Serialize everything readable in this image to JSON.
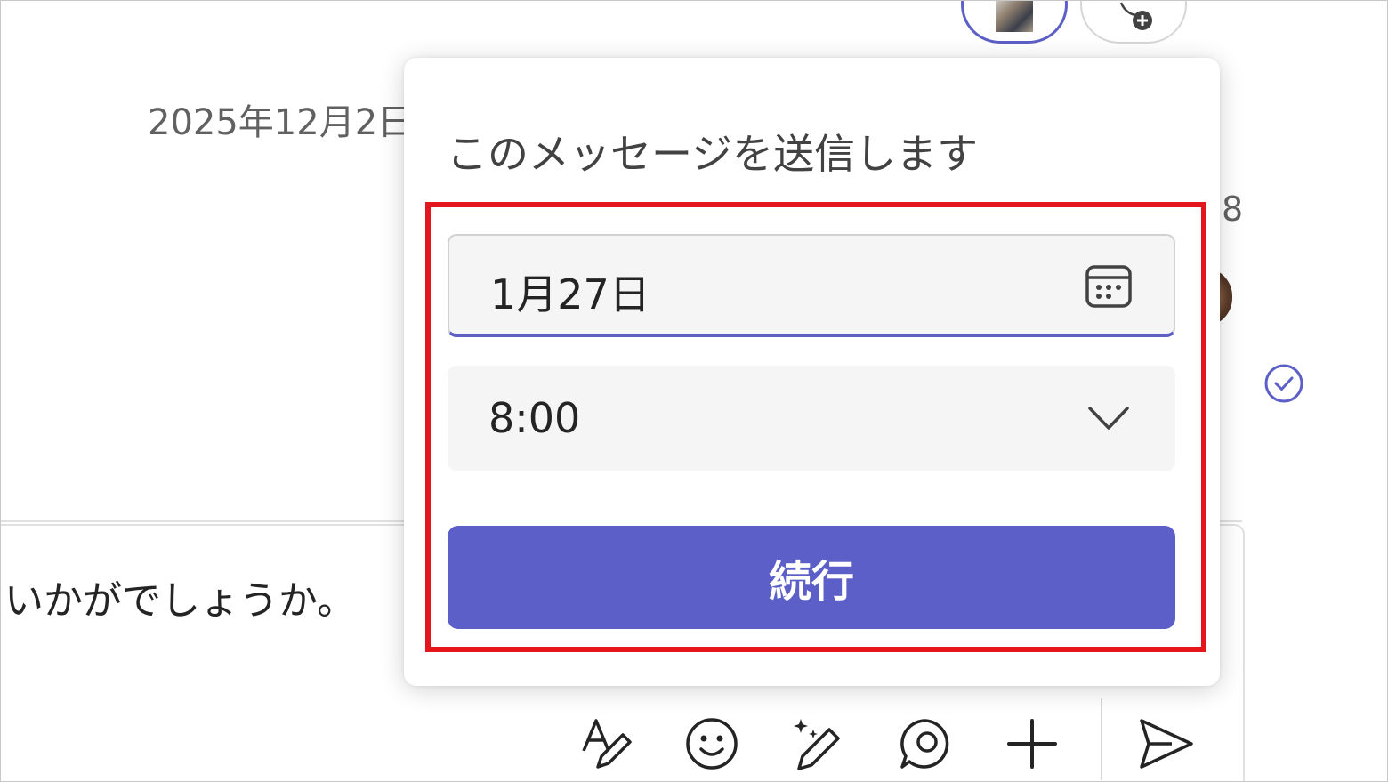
{
  "chat": {
    "date_header": "2025年12月2日",
    "side_digit": "8",
    "compose_text": "いかがでしょうか。"
  },
  "schedule_popup": {
    "title": "このメッセージを送信します",
    "date_value": "1月27日",
    "time_value": "8:00",
    "continue_label": "続行"
  },
  "toolbar": {
    "items": [
      "format-icon",
      "emoji-icon",
      "copilot-icon",
      "loop-icon",
      "add-icon",
      "send-icon"
    ]
  },
  "colors": {
    "accent": "#5b5fc7",
    "highlight": "#e3161d"
  }
}
